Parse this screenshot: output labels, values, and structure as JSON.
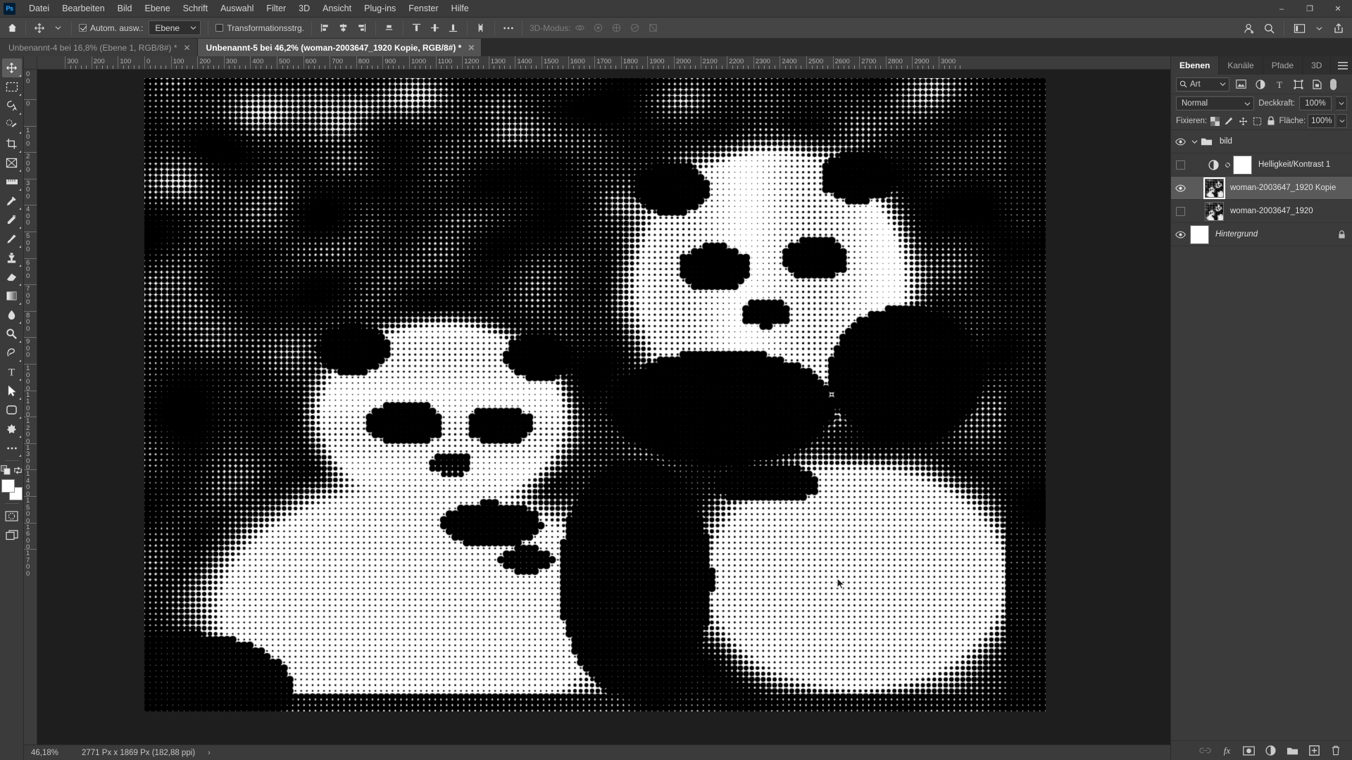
{
  "app": {
    "logo": "Ps",
    "name": "Adobe Photoshop"
  },
  "menubar": {
    "items": [
      "Datei",
      "Bearbeiten",
      "Bild",
      "Ebene",
      "Schrift",
      "Auswahl",
      "Filter",
      "3D",
      "Ansicht",
      "Plug-ins",
      "Fenster",
      "Hilfe"
    ]
  },
  "window_controls": {
    "minimize": "–",
    "maximize": "❐",
    "close": "✕"
  },
  "options_bar": {
    "home_icon": "home-icon",
    "tool_icon": "move-tool-icon",
    "auto_select_label": "Autom. ausw.:",
    "auto_select_checked": true,
    "auto_select_target": "Ebene",
    "transform_controls_label": "Transformationsstrg.",
    "transform_controls_checked": false,
    "align_icons": [
      "align-left-edges",
      "align-horizontal-centers",
      "align-right-edges",
      "align-top-edges",
      "distribute-top",
      "distribute-vertical-centers",
      "distribute-bottom",
      "distribute-spacing"
    ],
    "more_label": "•••",
    "threed_mode_label": "3D-Modus:",
    "threed_icons": [
      "orbit-3d",
      "roll-3d",
      "pan-3d",
      "slide-3d",
      "scale-3d"
    ],
    "right_icons": [
      "add-user-icon",
      "search-icon",
      "workspace-icon",
      "chevron-down-icon",
      "share-icon"
    ]
  },
  "tabs": [
    {
      "label": "Unbenannt-4 bei 16,8% (Ebene 1, RGB/8#) *",
      "close": "✕",
      "active": false
    },
    {
      "label": "Unbenannt-5 bei 46,2% (woman-2003647_1920 Kopie, RGB/8#) *",
      "close": "✕",
      "active": true
    }
  ],
  "toolbar": {
    "tools": [
      {
        "name": "move-tool",
        "active": true
      },
      {
        "name": "rectangular-marquee-tool",
        "active": false
      },
      {
        "name": "lasso-tool",
        "active": false
      },
      {
        "name": "quick-selection-tool",
        "active": false
      },
      {
        "name": "crop-tool",
        "active": false
      },
      {
        "name": "frame-tool",
        "active": false
      },
      {
        "name": "eyedropper-tool",
        "active": false
      },
      {
        "name": "spot-healing-brush-tool",
        "active": false
      },
      {
        "name": "brush-tool",
        "active": false
      },
      {
        "name": "clone-stamp-tool",
        "active": false
      },
      {
        "name": "history-brush-tool",
        "active": false
      },
      {
        "name": "eraser-tool",
        "active": false
      },
      {
        "name": "gradient-tool",
        "active": false
      },
      {
        "name": "blur-tool",
        "active": false
      },
      {
        "name": "dodge-tool",
        "active": false
      },
      {
        "name": "pen-tool",
        "active": false
      },
      {
        "name": "type-tool",
        "active": false
      },
      {
        "name": "path-selection-tool",
        "active": false
      },
      {
        "name": "rectangle-tool",
        "active": false
      },
      {
        "name": "hand-tool",
        "active": false
      },
      {
        "name": "zoom-tool",
        "active": false
      },
      {
        "name": "edit-toolbar-more",
        "active": false
      }
    ],
    "foreground_color": "#ffffff",
    "background_color": "#ffffff",
    "quick_mask": "quick-mask-icon",
    "screen_mode": "screen-mode-icon"
  },
  "rulers": {
    "horizontal_labels": [
      "300",
      "200",
      "100",
      "0",
      "100",
      "200",
      "300",
      "400",
      "500",
      "600",
      "700",
      "800",
      "900",
      "1000",
      "1100",
      "1200",
      "1300",
      "1400",
      "1500",
      "1600",
      "1700",
      "1800",
      "1900",
      "2000",
      "2100",
      "2200",
      "2300",
      "2400",
      "2500",
      "2600",
      "2700",
      "2800",
      "2900",
      "3000"
    ],
    "vertical_labels": [
      "00",
      "0",
      "100",
      "200",
      "300",
      "400",
      "500",
      "600",
      "700",
      "800",
      "900",
      "1000",
      "1100",
      "1200",
      "1300",
      "1400",
      "1500",
      "1600",
      "1700"
    ],
    "unit": "Px"
  },
  "status_bar": {
    "zoom": "46,18%",
    "dimensions": "2771 Px x 1869 Px (182,88 ppi)",
    "expand_arrow": "›"
  },
  "panel": {
    "tabs": [
      {
        "label": "Ebenen",
        "active": true
      },
      {
        "label": "Kanäle",
        "active": false
      },
      {
        "label": "Pfade",
        "active": false
      },
      {
        "label": "3D",
        "active": false
      }
    ],
    "menu_icon": "panel-menu-icon",
    "filter": {
      "search_icon": "search-icon",
      "kind_label": "Art",
      "chevron": "⌄",
      "icons": [
        "filter-pixel-icon",
        "filter-adjustment-icon",
        "filter-type-icon",
        "filter-shape-icon",
        "filter-smart-object-icon"
      ],
      "toggle": "filter-toggle"
    },
    "blend": {
      "mode": "Normal",
      "chevron": "⌄",
      "opacity_label": "Deckkraft:",
      "opacity_value": "100%"
    },
    "lock": {
      "label": "Fixieren:",
      "icons": [
        "lock-transparency-icon",
        "lock-image-icon",
        "lock-position-icon",
        "lock-artboard-icon",
        "lock-all-icon"
      ],
      "fill_label": "Fläche:",
      "fill_value": "100%"
    },
    "layers": [
      {
        "name": "bild",
        "type": "group",
        "visible": true,
        "selected": false,
        "expanded": true,
        "indent": 0,
        "locked": false,
        "italic": false
      },
      {
        "name": "Helligkeit/Kontrast 1",
        "type": "adjustment",
        "visible": false,
        "selected": false,
        "indent": 1,
        "locked": false,
        "italic": false
      },
      {
        "name": "woman-2003647_1920 Kopie",
        "type": "image",
        "visible": true,
        "selected": true,
        "indent": 1,
        "locked": false,
        "italic": false
      },
      {
        "name": "woman-2003647_1920",
        "type": "image",
        "visible": false,
        "selected": false,
        "indent": 1,
        "locked": false,
        "italic": false
      },
      {
        "name": "Hintergrund",
        "type": "background",
        "visible": true,
        "selected": false,
        "indent": 0,
        "locked": true,
        "italic": true
      }
    ],
    "bottom_icons": [
      "link-layers-icon",
      "layer-style-fx-icon",
      "add-layer-mask-icon",
      "new-adjustment-layer-icon",
      "new-group-icon",
      "new-layer-icon",
      "delete-layer-icon"
    ]
  },
  "document": {
    "render": "halftone-dithered-black-and-white-photo",
    "zoom_percent": "46,2%"
  }
}
